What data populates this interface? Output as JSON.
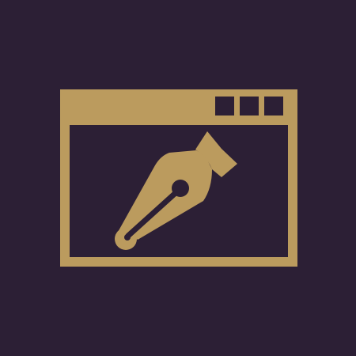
{
  "icon": {
    "name": "browser-window-pen-nib-icon",
    "window_icon": "browser-window-icon",
    "nib_icon": "fountain-pen-nib-icon",
    "window_buttons": [
      "window-button-icon",
      "window-button-icon",
      "window-button-icon"
    ]
  },
  "colors": {
    "background": "#2c1f35",
    "foreground": "#bb9b5e"
  }
}
